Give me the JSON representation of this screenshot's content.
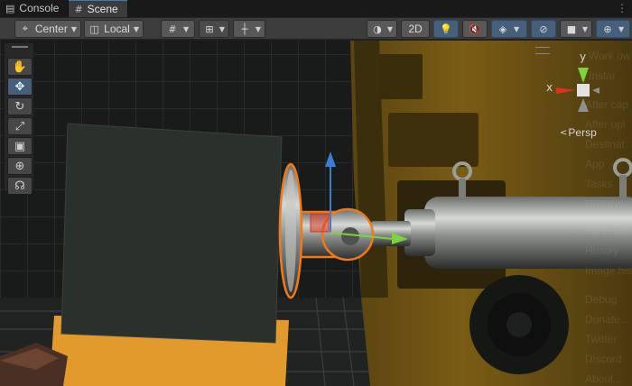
{
  "tabs": [
    {
      "label": "Console",
      "icon": "console-icon"
    },
    {
      "label": "Scene",
      "icon": "scene-grid-icon"
    }
  ],
  "toolbar": {
    "pivot_label": "Center",
    "space_label": "Local",
    "dimension_label": "2D"
  },
  "gizmo": {
    "x_label": "x",
    "y_label": "y",
    "projection_label": "Persp"
  },
  "background_panel": {
    "items": [
      "Work ow",
      "Instar",
      "After cap",
      "After upl",
      "Destinat",
      "App",
      "Tasks",
      "Hotkeys",
      "Screensh",
      "History",
      "Image his",
      "Debug",
      "Donate...",
      "Twitter",
      "Discord",
      "About..."
    ]
  },
  "colors": {
    "accent": "#3a79bb",
    "selection_outline": "#f07a1a",
    "x_axis": "#d9341e",
    "y_axis": "#7ad43c",
    "z_axis": "#3b7dd8",
    "floor": "#e39a2c"
  }
}
